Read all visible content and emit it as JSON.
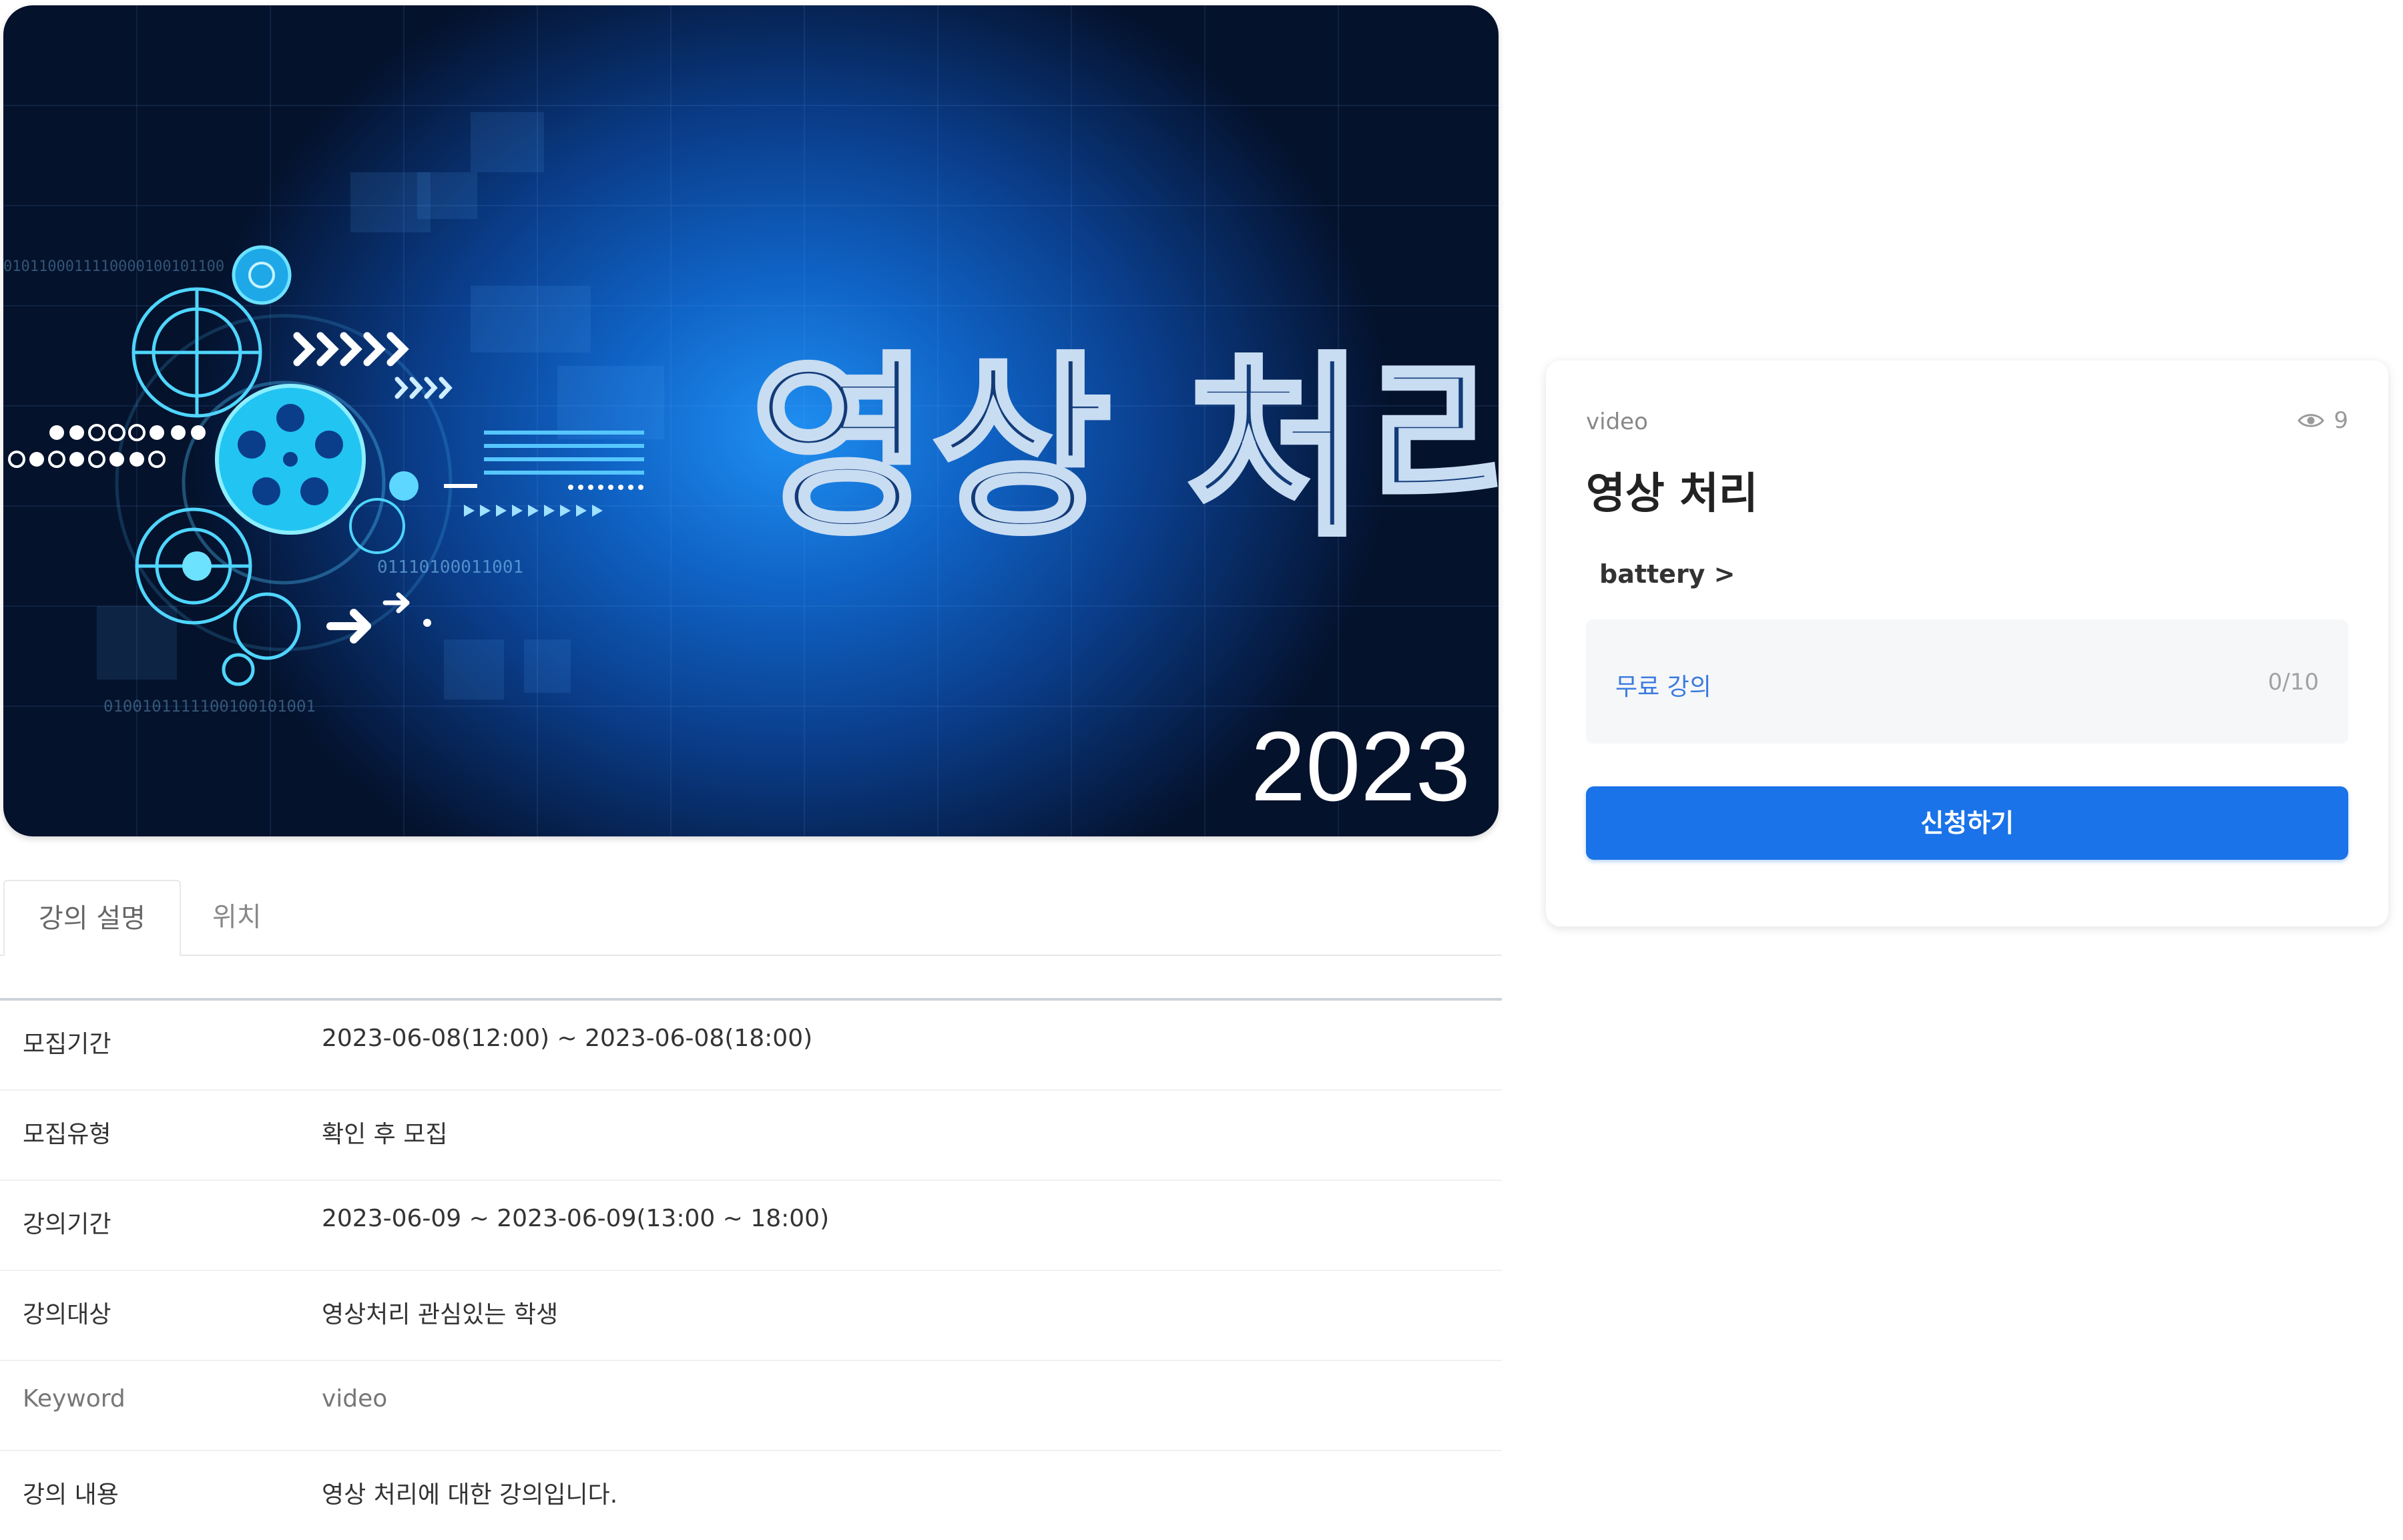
{
  "banner": {
    "title": "영상 처리",
    "year": "2023",
    "binary_text_1": "01110100011001",
    "binary_text_2": "0101100011110000100101100",
    "binary_text_3": "0100101111100100101001"
  },
  "tabs": [
    {
      "label": "강의 설명",
      "active": true
    },
    {
      "label": "위치",
      "active": false
    }
  ],
  "info": {
    "rows": [
      {
        "label": "모집기간",
        "value": "2023-06-08(12:00) ~ 2023-06-08(18:00)"
      },
      {
        "label": "모집유형",
        "value": "확인 후 모집"
      },
      {
        "label": "강의기간",
        "value": "2023-06-09 ~ 2023-06-09(13:00 ~ 18:00)"
      },
      {
        "label": "강의대상",
        "value": "영상처리 관심있는 학생"
      },
      {
        "label": "Keyword",
        "value": "video"
      },
      {
        "label": "강의 내용",
        "value": "영상 처리에 대한 강의입니다."
      }
    ]
  },
  "card": {
    "keyword": "video",
    "views": "9",
    "title": "영상 처리",
    "category": "battery >",
    "free_label": "무료 강의",
    "capacity": "0/10",
    "apply_label": "신청하기"
  },
  "colors": {
    "accent": "#1a73e8",
    "banner_dark": "#061f4a",
    "banner_light": "#1f8ff2",
    "free_text": "#3b7be0"
  }
}
